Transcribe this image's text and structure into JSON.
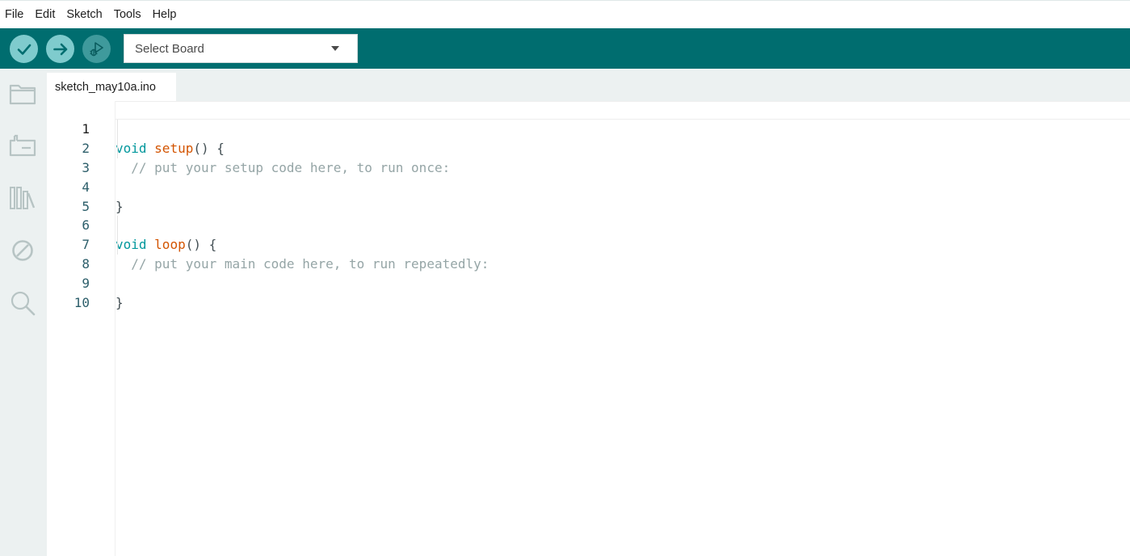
{
  "menu": {
    "items": [
      "File",
      "Edit",
      "Sketch",
      "Tools",
      "Help"
    ]
  },
  "toolbar": {
    "verify_icon": "check-icon",
    "upload_icon": "arrow-right-icon",
    "debug_icon": "debug-icon",
    "board_select": {
      "label": "Select Board",
      "icon": "chevron-down-icon"
    },
    "colors": {
      "background": "#006d6f",
      "button": "#7fcbcd",
      "button_disabled": "#3f9a9c"
    }
  },
  "sidebar": {
    "items": [
      {
        "name": "sketchbook",
        "icon": "folder-icon"
      },
      {
        "name": "boards-manager",
        "icon": "board-icon"
      },
      {
        "name": "library-manager",
        "icon": "library-icon"
      },
      {
        "name": "debug",
        "icon": "no-debug-icon"
      },
      {
        "name": "search",
        "icon": "search-icon"
      }
    ]
  },
  "editor": {
    "tabs": [
      {
        "label": "sketch_may10a.ino"
      }
    ],
    "line_numbers": [
      "1",
      "2",
      "3",
      "4",
      "5",
      "6",
      "7",
      "8",
      "9",
      "10"
    ],
    "code": {
      "l1": {
        "kw": "void",
        "fn": "setup",
        "rest": "() {"
      },
      "l2": {
        "comment": "// put your setup code here, to run once:"
      },
      "l4": {
        "rest": "}"
      },
      "l6": {
        "kw": "void",
        "fn": "loop",
        "rest": "() {"
      },
      "l7": {
        "comment": "// put your main code here, to run repeatedly:"
      },
      "l9": {
        "rest": "}"
      }
    },
    "syntax_colors": {
      "keyword": "#00979c",
      "function": "#d35400",
      "comment": "#95a5a6"
    }
  }
}
